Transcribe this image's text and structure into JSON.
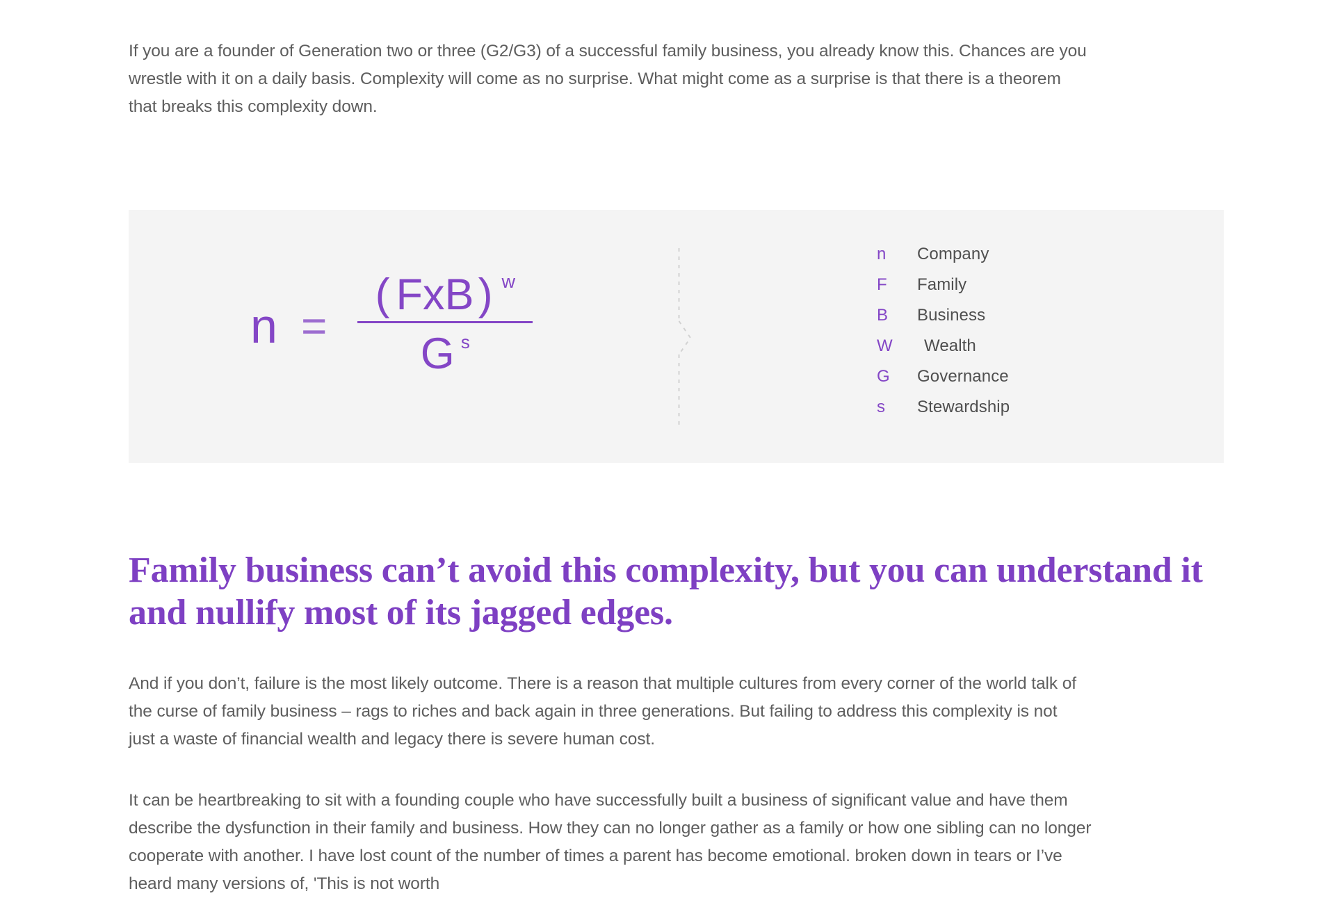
{
  "article": {
    "paragraphs": {
      "intro": "If you are a founder of Generation two or three (G2/G3) of a successful family business, you already know this. Chances are you wrestle with it on a daily basis. Complexity will come as no surprise. What might come as a surprise is that there is a theorem that breaks this complexity down.",
      "after_heading": "And if you don’t, failure is the most likely outcome. There is a reason that multiple cultures from every corner of the world talk of the curse of family business – rags to riches and back again in three generations. But failing to address this complexity is not just a waste of financial wealth and legacy there is severe human cost.",
      "closing": "It can be heartbreaking to sit with a founding couple who have successfully built a business of significant value and have them describe the dysfunction in their family and business. How they can no longer gather as a family or how one sibling can no longer cooperate with another. I have lost count of the number of times a parent has become emotional. broken down in tears or I’ve heard many versions of, 'This is not worth"
    },
    "heading": "Family business can’t avoid this complexity, but you can understand it and nullify most of its jagged edges."
  },
  "formula_panel": {
    "formula": {
      "result": "n",
      "equals": "=",
      "numerator_open_paren": "(",
      "numerator_body": "FxB",
      "numerator_close_paren": ")",
      "numerator_exponent": "w",
      "denominator_base": "G",
      "denominator_exponent": "s"
    },
    "legend": [
      {
        "symbol": "n",
        "label": "Company"
      },
      {
        "symbol": "F",
        "label": "Family"
      },
      {
        "symbol": "B",
        "label": "Business"
      },
      {
        "symbol": "W",
        "label": "Wealth"
      },
      {
        "symbol": "G",
        "label": "Governance"
      },
      {
        "symbol": "s",
        "label": "Stewardship"
      }
    ]
  },
  "colors": {
    "panel_background": "#f4f4f4",
    "formula_purple": "#8446c6",
    "heading_purple": "#7e40c3",
    "body_text": "#5e5e5e",
    "legend_label": "#4f4f4f",
    "connector_gray": "#cfcfcf",
    "page_background": "#ffffff"
  }
}
